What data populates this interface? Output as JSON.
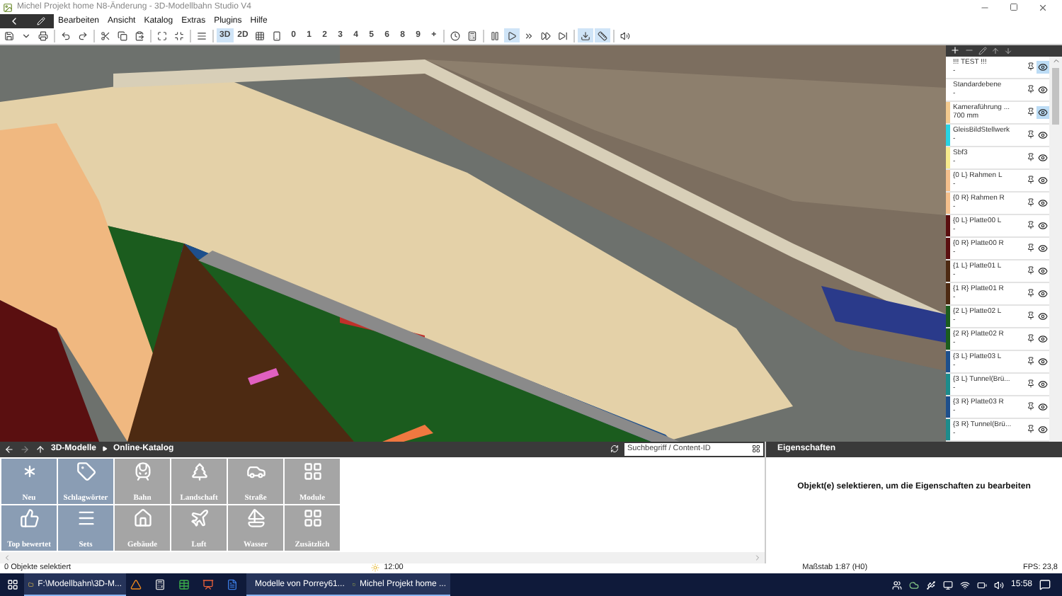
{
  "window": {
    "title": "Michel Projekt home N8-Änderung - 3D-Modellbahn Studio V4"
  },
  "menu": [
    "Bearbeiten",
    "Ansicht",
    "Katalog",
    "Extras",
    "Plugins",
    "Hilfe"
  ],
  "toolbar": [
    {
      "kind": "icon",
      "selected": false
    },
    {
      "kind": "icon",
      "selected": false
    },
    {
      "kind": "icon",
      "selected": false
    },
    {
      "kind": "sep"
    },
    {
      "kind": "icon",
      "selected": false
    },
    {
      "kind": "icon",
      "selected": false
    },
    {
      "kind": "sep"
    },
    {
      "kind": "icon",
      "selected": false
    },
    {
      "kind": "icon",
      "selected": false
    },
    {
      "kind": "icon",
      "selected": false
    },
    {
      "kind": "sep"
    },
    {
      "kind": "icon",
      "selected": false
    },
    {
      "kind": "icon",
      "selected": false
    },
    {
      "kind": "sep"
    },
    {
      "kind": "icon",
      "selected": false
    },
    {
      "kind": "sep"
    },
    {
      "kind": "text",
      "label": "3D",
      "selected": true
    },
    {
      "kind": "text",
      "label": "2D",
      "selected": false
    },
    {
      "kind": "icon",
      "selected": false
    },
    {
      "kind": "icon",
      "selected": false
    },
    {
      "kind": "text",
      "label": "0",
      "selected": false
    },
    {
      "kind": "text",
      "label": "1",
      "selected": false
    },
    {
      "kind": "text",
      "label": "2",
      "selected": false
    },
    {
      "kind": "text",
      "label": "3",
      "selected": false
    },
    {
      "kind": "text",
      "label": "4",
      "selected": false
    },
    {
      "kind": "text",
      "label": "5",
      "selected": false
    },
    {
      "kind": "text",
      "label": "6",
      "selected": false
    },
    {
      "kind": "text",
      "label": "8",
      "selected": false
    },
    {
      "kind": "text",
      "label": "9",
      "selected": false
    },
    {
      "kind": "text",
      "label": "+",
      "selected": false
    },
    {
      "kind": "sep"
    },
    {
      "kind": "icon",
      "selected": false
    },
    {
      "kind": "icon",
      "selected": false
    },
    {
      "kind": "sep"
    },
    {
      "kind": "icon",
      "selected": false
    },
    {
      "kind": "icon",
      "selected": true
    },
    {
      "kind": "icon",
      "selected": false
    },
    {
      "kind": "icon",
      "selected": false
    },
    {
      "kind": "icon",
      "selected": false
    },
    {
      "kind": "sep"
    },
    {
      "kind": "icon",
      "selected": true
    },
    {
      "kind": "icon",
      "selected": true
    },
    {
      "kind": "sep"
    },
    {
      "kind": "icon",
      "selected": false
    }
  ],
  "layers": {
    "items": [
      {
        "name": "!!! TEST !!!",
        "detail": "-",
        "eye_highlighted": true
      },
      {
        "name": "Standardebene",
        "detail": "-",
        "eye_highlighted": false
      },
      {
        "name": "Kameraführung ...",
        "detail": "700 mm",
        "color": "#f2c98e",
        "eye_highlighted": true
      },
      {
        "name": "GleisBildStellwerk",
        "detail": "-",
        "color": "#27d3e3",
        "eye_highlighted": false
      },
      {
        "name": "Sbf3",
        "detail": "-",
        "color": "#f7ea8c",
        "eye_highlighted": false
      },
      {
        "name": "{0 L} Rahmen L",
        "detail": "-",
        "color": "#f4bf8c",
        "eye_highlighted": false
      },
      {
        "name": "{0 R} Rahmen R",
        "detail": "-",
        "color": "#f4bf8c",
        "eye_highlighted": false
      },
      {
        "name": "{0 L} Platte00 L",
        "detail": "-",
        "color": "#5a0f10",
        "eye_highlighted": false
      },
      {
        "name": "{0 R} Platte00 R",
        "detail": "-",
        "color": "#5a0f10",
        "eye_highlighted": false
      },
      {
        "name": "{1 L} Platte01 L",
        "detail": "-",
        "color": "#4d2a12",
        "eye_highlighted": false
      },
      {
        "name": "{1 R} Platte01 R",
        "detail": "-",
        "color": "#4d2a12",
        "eye_highlighted": false
      },
      {
        "name": "{2 L} Platte02 L",
        "detail": "-",
        "color": "#1b5c1e",
        "eye_highlighted": false
      },
      {
        "name": "{2 R} Platte02 R",
        "detail": "-",
        "color": "#1b5c1e",
        "eye_highlighted": false
      },
      {
        "name": "{3 L} Platte03 L",
        "detail": "-",
        "color": "#1e4f8c",
        "eye_highlighted": false
      },
      {
        "name": "{3 L} Tunnel(Brü...",
        "detail": "-",
        "color": "#1c8c8c",
        "eye_highlighted": false
      },
      {
        "name": "{3 R} Platte03 R",
        "detail": "-",
        "color": "#1e4f8c",
        "eye_highlighted": false
      },
      {
        "name": "{3 R} Tunnel(Brü...",
        "detail": "-",
        "color": "#1c8c8c",
        "eye_highlighted": false
      }
    ]
  },
  "catalog": {
    "breadcrumb": [
      "3D-Modelle",
      "Online-Katalog"
    ],
    "search": {
      "placeholder": "Suchbegriff / Content-ID"
    },
    "tiles": [
      {
        "label": "Neu",
        "kind": "special"
      },
      {
        "label": "Schlagwörter",
        "kind": "special"
      },
      {
        "label": "Bahn",
        "kind": "category"
      },
      {
        "label": "Landschaft",
        "kind": "category"
      },
      {
        "label": "Straße",
        "kind": "category"
      },
      {
        "label": "Module",
        "kind": "category"
      },
      {
        "label": "Top bewertet",
        "kind": "special"
      },
      {
        "label": "Sets",
        "kind": "special"
      },
      {
        "label": "Gebäude",
        "kind": "category"
      },
      {
        "label": "Luft",
        "kind": "category"
      },
      {
        "label": "Wasser",
        "kind": "category"
      },
      {
        "label": "Zusätzlich",
        "kind": "category"
      }
    ]
  },
  "properties": {
    "title": "Eigenschaften",
    "message": "Objekt(e) selektieren, um die Eigenschaften zu bearbeiten"
  },
  "status_bar": {
    "selection": "0 Objekte selektiert",
    "time": "12:00",
    "scale": "Maßstab 1:87 (H0)",
    "fps": "FPS: 23,8"
  },
  "taskbar": {
    "items": [
      {
        "kind": "labeled",
        "label": "F:\\Modellbahn\\3D-M...",
        "active": true
      },
      {
        "kind": "icon",
        "active": false
      },
      {
        "kind": "icon",
        "active": false
      },
      {
        "kind": "icon",
        "active": false
      },
      {
        "kind": "icon",
        "active": false
      },
      {
        "kind": "icon",
        "active": false
      },
      {
        "kind": "labeled",
        "label": "Modelle von Porrey61...",
        "active": true
      },
      {
        "kind": "labeled",
        "label": "Michel Projekt home ...",
        "active": true
      }
    ],
    "clock": "15:58"
  }
}
